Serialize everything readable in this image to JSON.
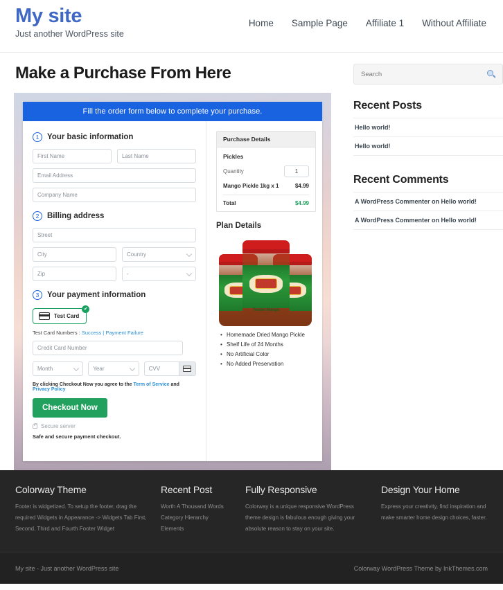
{
  "header": {
    "brand_title": "My site",
    "tagline": "Just another WordPress site",
    "nav": [
      {
        "label": "Home"
      },
      {
        "label": "Sample Page"
      },
      {
        "label": "Affiliate 1"
      },
      {
        "label": "Without Affiliate"
      }
    ]
  },
  "main": {
    "page_title": "Make a Purchase From Here",
    "form_banner": "Fill the order form below to complete your purchase.",
    "step1": {
      "number": "1",
      "title": "Your basic information",
      "first_name_placeholder": "First Name",
      "last_name_placeholder": "Last Name",
      "email_placeholder": "Email Address",
      "company_placeholder": "Company Name"
    },
    "step2": {
      "number": "2",
      "title": "Billing address",
      "street_placeholder": "Street",
      "city_placeholder": "City",
      "country_placeholder": "Country",
      "zip_placeholder": "Zip",
      "state_placeholder": "-"
    },
    "step3": {
      "number": "3",
      "title": "Your payment information",
      "test_card_label": "Test  Card",
      "check_glyph": "✔",
      "test_numbers_prefix": "Test Card Numbers : ",
      "success_link": "Success",
      "separator": " | ",
      "failure_link": "Payment Failure",
      "card_number_placeholder": "Credit Card Number",
      "month_placeholder": "Month",
      "year_placeholder": "Year",
      "cvv_placeholder": "CVV",
      "terms_prefix": "By clicking Checkout Now you agree to the ",
      "terms_link": "Term of Service",
      "terms_and": " and ",
      "privacy_link": "Privacy Policy",
      "checkout_label": "Checkout Now",
      "secure_server": "Secure server",
      "safe_note": "Safe and secure payment checkout."
    },
    "purchase_details": {
      "heading": "Purchase Details",
      "product_group": "Pickles",
      "quantity_label": "Quantity",
      "quantity_value": "1",
      "item_label": "Mango Pickle 1kg x 1",
      "item_price": "$4.99",
      "total_label": "Total",
      "total_value": "$4.99"
    },
    "plan_details": {
      "heading": "Plan Details",
      "jar_label": "Tender Mango",
      "features": [
        "Homemade Dried Mango Pickle",
        "Shelf Life of 24 Months",
        "No Artificial Color",
        "No Added Preservation"
      ]
    }
  },
  "sidebar": {
    "search_placeholder": "Search",
    "recent_posts_title": "Recent Posts",
    "recent_posts": [
      {
        "label": "Hello world!"
      },
      {
        "label": "Hello world!"
      }
    ],
    "recent_comments_title": "Recent Comments",
    "recent_comments": [
      {
        "label": "A WordPress Commenter on Hello world!"
      },
      {
        "label": "A WordPress Commenter on Hello world!"
      }
    ]
  },
  "footer": {
    "columns": [
      {
        "title": "Colorway Theme",
        "text": "Footer is widgetized. To setup the footer, drag the required Widgets in Appearance -> Widgets Tab First, Second, Third and Fourth Footer Widget"
      },
      {
        "title": "Recent Post",
        "items": [
          {
            "label": "Worth A Thousand Words"
          },
          {
            "label": "Category Hierarchy"
          },
          {
            "label": "Elements"
          }
        ]
      },
      {
        "title": "Fully Responsive",
        "text": "Colorway is a unique responsive WordPress theme design is fabulous enough giving your absolute reason to stay on your site."
      },
      {
        "title": "Design Your Home",
        "text": "Express your creativity, find inspiration and make smarter home design choices, faster."
      }
    ],
    "bottom_left": "My site - Just another WordPress site",
    "bottom_right": "Colorway WordPress Theme by InkThemes.com"
  },
  "colors": {
    "brand_blue": "#3f68c4",
    "banner_blue": "#1a63e0",
    "green": "#22a05e",
    "link_blue": "#2a8fd8",
    "footer_dark": "#262626"
  }
}
